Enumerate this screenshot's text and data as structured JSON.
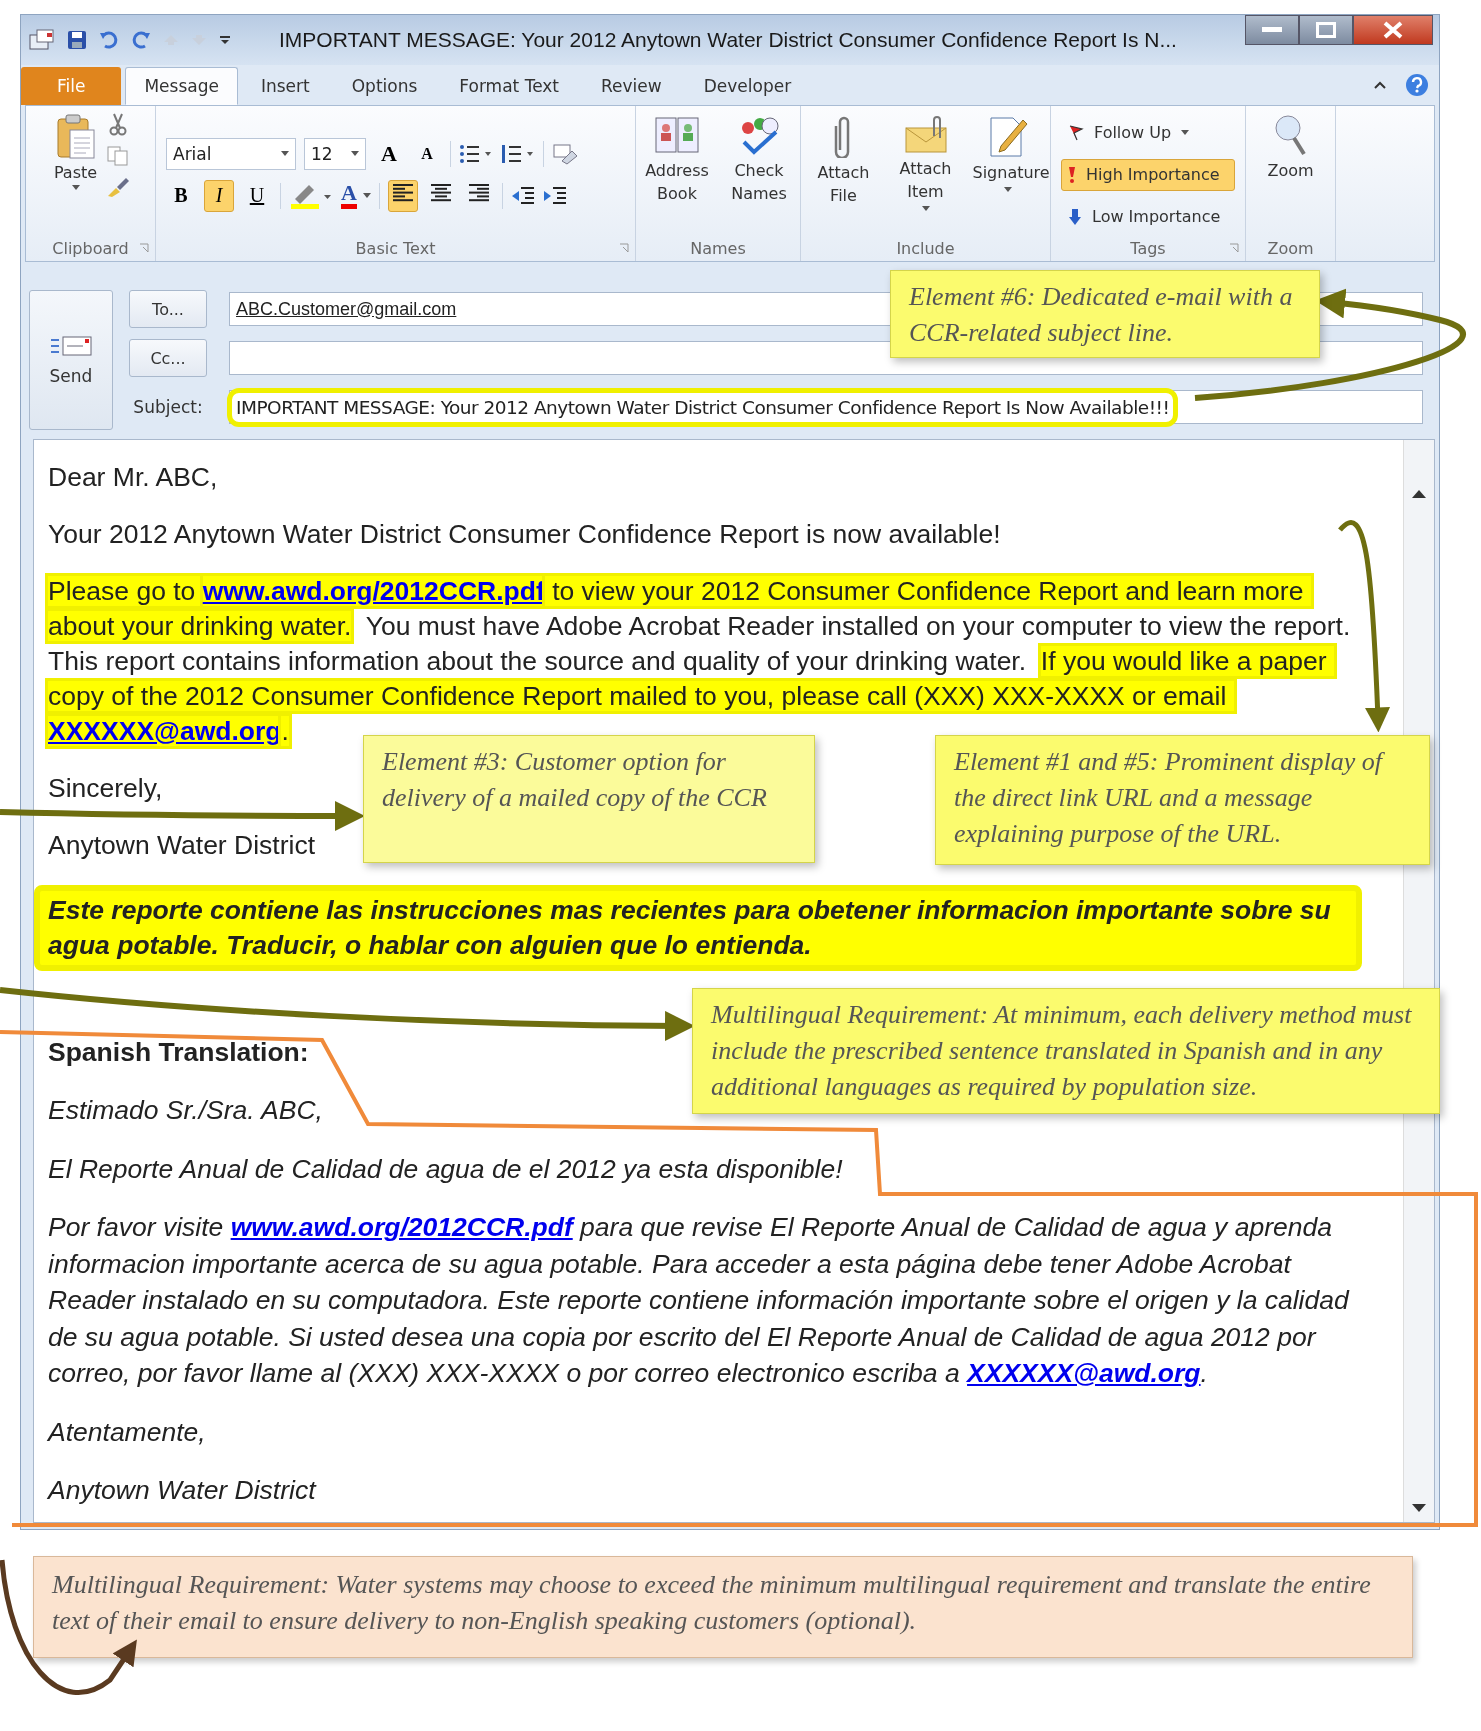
{
  "window": {
    "title": "IMPORTANT MESSAGE:  Your 2012 Anytown Water District Consumer Confidence Report Is N..."
  },
  "tabs": [
    {
      "label": "File",
      "kind": "file",
      "selected": false
    },
    {
      "label": "Message",
      "kind": "tab",
      "selected": true
    },
    {
      "label": "Insert",
      "kind": "tab",
      "selected": false
    },
    {
      "label": "Options",
      "kind": "tab",
      "selected": false
    },
    {
      "label": "Format Text",
      "kind": "tab",
      "selected": false
    },
    {
      "label": "Review",
      "kind": "tab",
      "selected": false
    },
    {
      "label": "Developer",
      "kind": "tab",
      "selected": false
    }
  ],
  "ribbon": {
    "clipboard": {
      "label": "Clipboard",
      "paste": "Paste"
    },
    "basic_text": {
      "label": "Basic Text",
      "font": "Arial",
      "size": "12",
      "grow": "A",
      "shrink": "A",
      "font_color": "A",
      "format_buttons": [
        {
          "label": "B",
          "selected": false
        },
        {
          "label": "I",
          "selected": true
        },
        {
          "label": "U",
          "selected": false
        }
      ],
      "alignment": [
        {
          "selected": true
        },
        {
          "selected": false
        },
        {
          "selected": false
        }
      ]
    },
    "names": {
      "label": "Names",
      "buttons": [
        "Address Book",
        "Check Names"
      ]
    },
    "include": {
      "label": "Include",
      "buttons": [
        "Attach File",
        "Attach Item",
        "Signature"
      ]
    },
    "tags": {
      "label": "Tags",
      "items": [
        {
          "label": "Follow Up",
          "selected": false
        },
        {
          "label": "High Importance",
          "selected": true
        },
        {
          "label": "Low Importance",
          "selected": false
        }
      ]
    },
    "zoom": {
      "label": "Zoom",
      "button": "Zoom"
    }
  },
  "header": {
    "send": "Send",
    "to_button": "To...",
    "to": "ABC.Customer@gmail.com",
    "cc_button": "Cc...",
    "subject_label": "Subject:",
    "subject": "IMPORTANT MESSAGE:  Your 2012 Anytown Water District Consumer Confidence Report Is Now Available!!!"
  },
  "body": [
    {
      "kind": "plain",
      "segments": [
        {
          "text": "Dear Mr. ABC,"
        }
      ]
    },
    {
      "kind": "plain",
      "segments": [
        {
          "text": "Your 2012 Anytown Water District Consumer Confidence Report is now available!"
        }
      ]
    },
    {
      "kind": "plain",
      "segments": [
        {
          "text": "Please go to ",
          "highlight": true
        },
        {
          "text": "www.awd.org/2012CCR.pdf",
          "link": true,
          "highlight": true
        },
        {
          "text": " to view your 2012 Consumer Confidence Report and learn more about your drinking water.",
          "highlight": true
        },
        {
          "text": "  You must have Adobe Acrobat Reader installed on your computer to view the report.  This report contains information about the source and quality of your drinking water.  "
        },
        {
          "text": "If you would like a paper copy of the 2012 Consumer Confidence Report mailed to you, please call (XXX) XXX-XXXX or email ",
          "highlight": true
        },
        {
          "text": "XXXXXX@awd.org",
          "link": true,
          "highlight": true
        },
        {
          "text": ".",
          "highlight": true
        }
      ]
    },
    {
      "kind": "plain",
      "segments": [
        {
          "text": "Sincerely,"
        }
      ]
    },
    {
      "kind": "plain",
      "segments": [
        {
          "text": "Anytown Water District"
        }
      ]
    },
    {
      "kind": "banner",
      "segments": [
        {
          "text": "Este reporte contiene las instrucciones mas recientes para obetener informacion importante sobre su agua potable. Traducir, o hablar con alguien que lo entienda."
        }
      ]
    },
    {
      "kind": "bold",
      "segments": [
        {
          "text": "Spanish Translation:"
        }
      ]
    },
    {
      "kind": "italic",
      "segments": [
        {
          "text": "Estimado Sr./Sra. ABC,"
        }
      ]
    },
    {
      "kind": "italic",
      "segments": [
        {
          "text": "El Reporte Anual de Calidad de agua de el 2012 ya esta disponible!"
        }
      ]
    },
    {
      "kind": "italic",
      "segments": [
        {
          "text": "Por favor visite "
        },
        {
          "text": "www.awd.org/2012CCR.pdf",
          "link": true
        },
        {
          "text": " para que revise El Reporte Anual de Calidad de agua y aprenda informacion importante acerca de su agua potable. Para acceder a esta página debe tener Adobe Acrobat Reader instalado en su computadora. Este reporte contiene información importante sobre el origen y la calidad de su agua potable. Si usted desea una copia por escrito del El Reporte Anual de Calidad de agua 2012 por correo, por favor llame al (XXX) XXX-XXXX o por correo electronico escriba a "
        },
        {
          "text": "XXXXXX@awd.org",
          "link": true
        },
        {
          "text": "."
        }
      ]
    },
    {
      "kind": "italic",
      "segments": [
        {
          "text": "Atentamente,"
        }
      ]
    },
    {
      "kind": "italic",
      "segments": [
        {
          "text": "Anytown Water District"
        }
      ]
    }
  ],
  "callouts": [
    "Element #6: Dedicated e-mail with a CCR-related subject line.",
    "Element #3: Customer option for delivery of a mailed copy of the CCR",
    "Element #1 and #5: Prominent display of the direct link URL and a message explaining purpose of the URL.",
    "Multilingual Requirement: At minimum, each delivery method must include the prescribed sentence translated in Spanish and in any additional languages as required by population size."
  ],
  "footer_note": "Multilingual Requirement: Water systems may choose to exceed the minimum multilingual requirement and translate the entire text of their email to ensure delivery to non-English speaking customers (optional)."
}
